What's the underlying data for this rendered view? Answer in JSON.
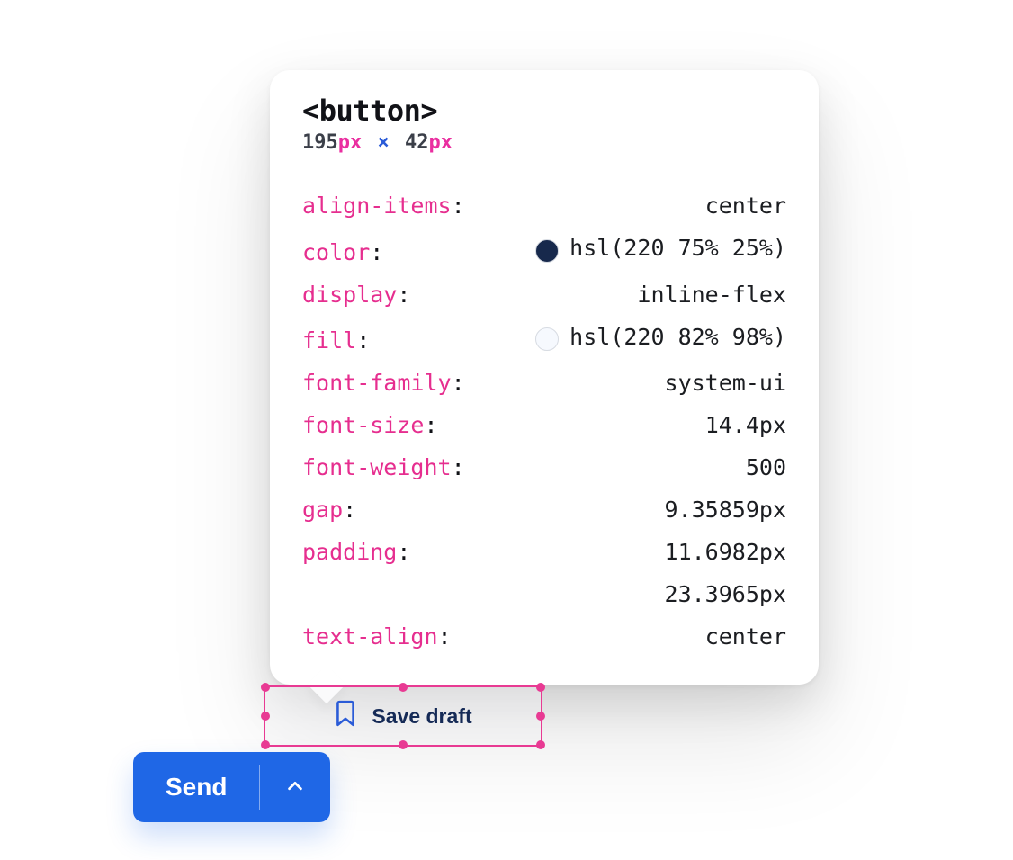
{
  "inspector": {
    "tag": "<button>",
    "dimensions": {
      "w": "195",
      "h": "42",
      "unit": "px"
    },
    "properties": [
      {
        "key": "align-items",
        "value": "center"
      },
      {
        "key": "color",
        "value": "hsl(220 75% 25%)",
        "swatch": "#17294c"
      },
      {
        "key": "display",
        "value": "inline-flex"
      },
      {
        "key": "fill",
        "value": "hsl(220 82% 98%)",
        "swatch": "#f6f9fe"
      },
      {
        "key": "font-family",
        "value": "system-ui"
      },
      {
        "key": "font-size",
        "value": "14.4px"
      },
      {
        "key": "font-weight",
        "value": "500"
      },
      {
        "key": "gap",
        "value": "9.35859px"
      },
      {
        "key": "padding",
        "value": "11.6982px",
        "value2": "23.3965px"
      },
      {
        "key": "text-align",
        "value": "center"
      }
    ]
  },
  "buttons": {
    "save_draft": "Save draft",
    "send": "Send"
  }
}
